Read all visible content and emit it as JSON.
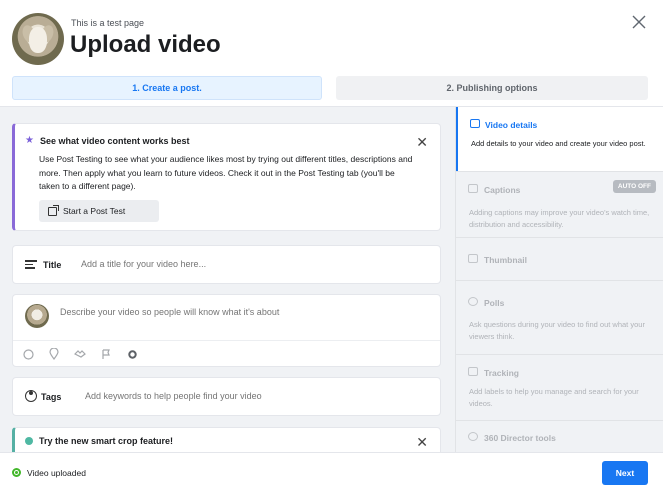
{
  "header": {
    "page_name": "This is a test page",
    "title": "Upload video"
  },
  "steps": [
    {
      "label": "1. Create a post.",
      "active": true
    },
    {
      "label": "2. Publishing options",
      "active": false
    }
  ],
  "tip": {
    "title": "See what video content works best",
    "body": "Use Post Testing to see what your audience likes most by trying out different titles, descriptions and more. Then apply what you learn to future videos. Check it out in the Post Testing tab (you'll be taken to a different page).",
    "button_label": "Start a Post Test"
  },
  "title_field": {
    "label": "Title",
    "placeholder": "Add a title for your video here..."
  },
  "description_field": {
    "placeholder": "Describe your video so people will know what it's about"
  },
  "tags_field": {
    "label": "Tags",
    "placeholder": "Add keywords to help people find your video"
  },
  "crop_tip": {
    "title": "Try the new smart crop feature!"
  },
  "sidebar": {
    "video_details": {
      "title": "Video details",
      "desc": "Add details to your video and create your video post."
    },
    "captions": {
      "title": "Captions",
      "badge": "AUTO OFF",
      "desc": "Adding captions may improve your video's watch time, distribution and accessibility."
    },
    "thumbnail": {
      "title": "Thumbnail"
    },
    "polls": {
      "title": "Polls",
      "desc": "Ask questions during your video to find out what your viewers think."
    },
    "tracking": {
      "title": "Tracking",
      "desc": "Add labels to help you manage and search for your videos."
    },
    "director": {
      "title": "360 Director tools"
    }
  },
  "footer": {
    "status": "Video uploaded",
    "next_label": "Next"
  },
  "colors": {
    "accent": "#1877f2",
    "success": "#42b72a",
    "tip_border": "#8a6ad8"
  }
}
